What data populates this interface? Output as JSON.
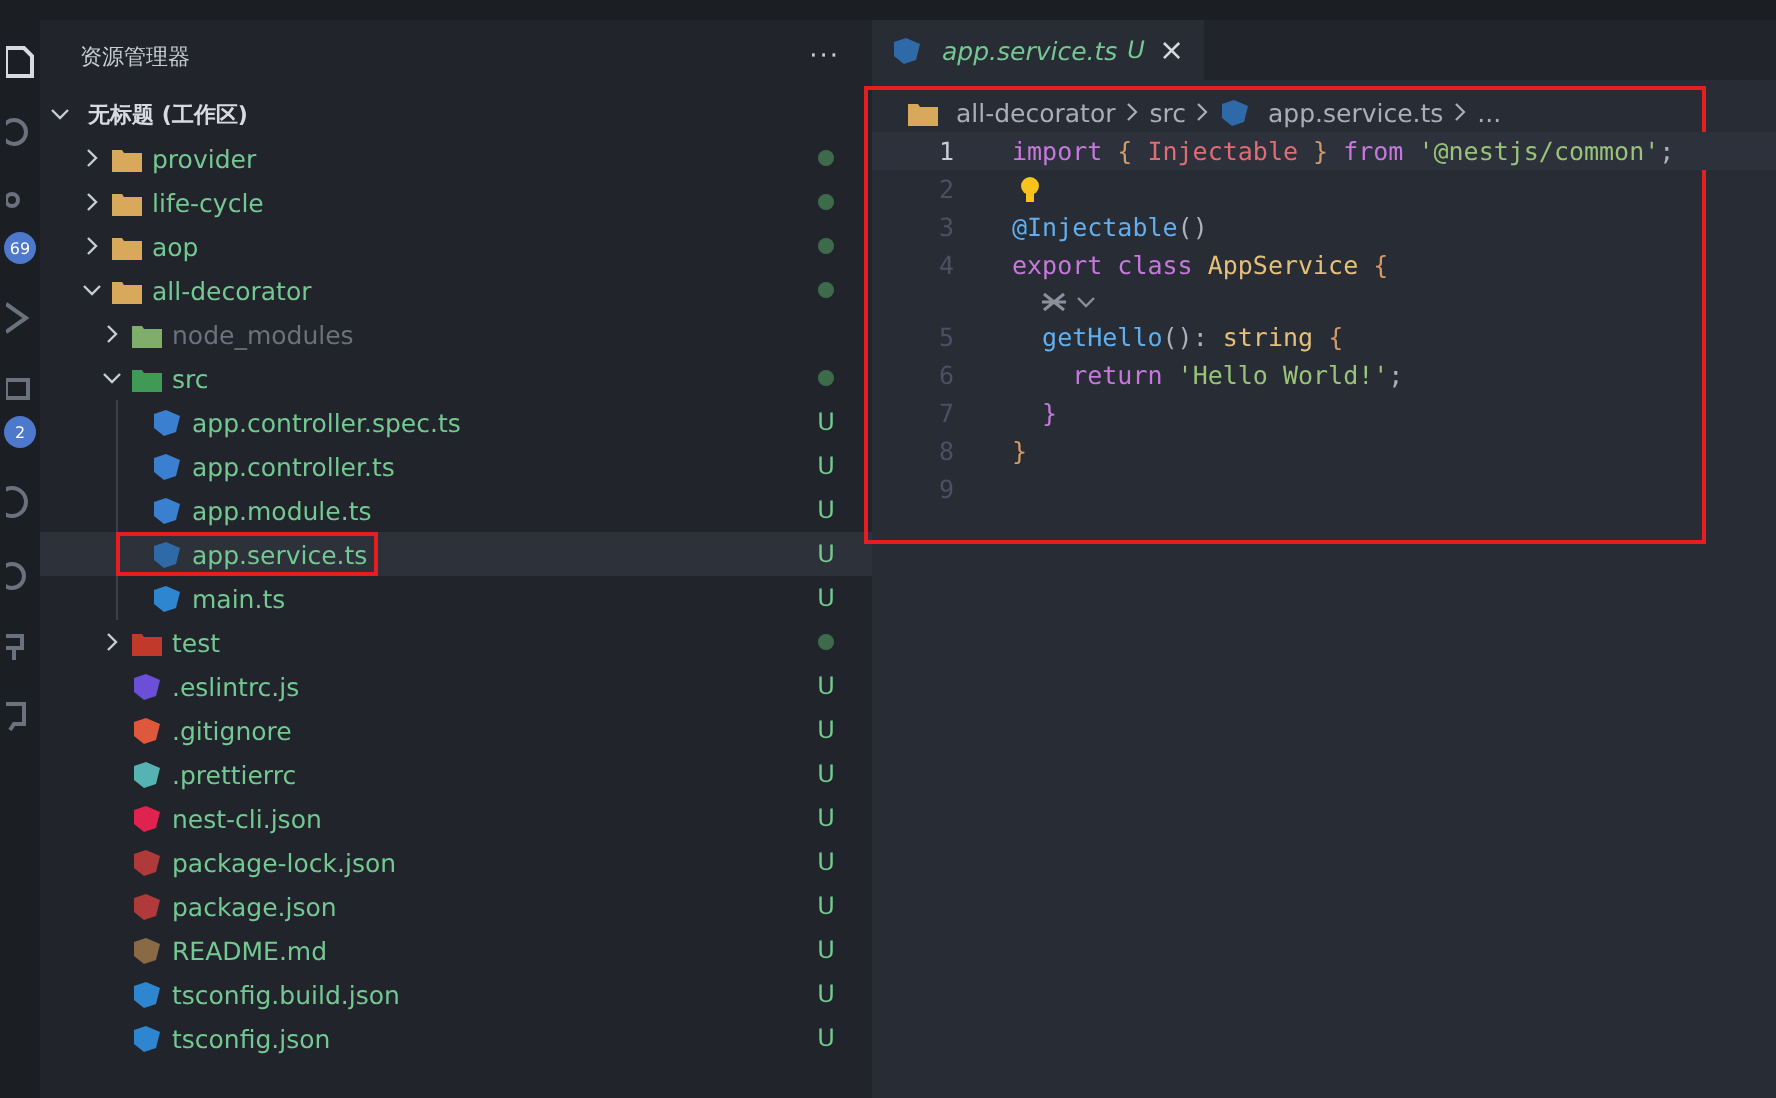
{
  "activity_bar": {
    "badges": [
      "69",
      "2"
    ]
  },
  "explorer": {
    "title": "资源管理器",
    "more": "···",
    "workspace": {
      "label": "无标题 (工作区)",
      "expanded": true
    },
    "tree": [
      {
        "name": "provider",
        "kind": "folder",
        "expanded": false,
        "changed": true,
        "selected": false,
        "dimmed": false,
        "highlighted": false,
        "color": "#d9a95b"
      },
      {
        "name": "life-cycle",
        "kind": "folder",
        "expanded": false,
        "changed": true,
        "selected": false,
        "dimmed": false,
        "highlighted": false,
        "color": "#d9a95b"
      },
      {
        "name": "aop",
        "kind": "folder",
        "expanded": false,
        "changed": true,
        "selected": false,
        "dimmed": false,
        "highlighted": false,
        "color": "#d9a95b"
      },
      {
        "name": "all-decorator",
        "kind": "folder",
        "expanded": true,
        "changed": true,
        "selected": false,
        "dimmed": false,
        "highlighted": false,
        "color": "#d9a95b",
        "children": [
          {
            "name": "node_modules",
            "kind": "folder",
            "expanded": false,
            "changed": false,
            "selected": false,
            "dimmed": true,
            "highlighted": false,
            "color": "#7fae6a"
          },
          {
            "name": "src",
            "kind": "folder",
            "expanded": true,
            "changed": true,
            "selected": false,
            "dimmed": false,
            "highlighted": false,
            "color": "#3f9a55",
            "children": [
              {
                "name": "app.controller.spec.ts",
                "kind": "file",
                "status": "U",
                "selected": false,
                "dimmed": false,
                "highlighted": false,
                "color": "#3a7fd0"
              },
              {
                "name": "app.controller.ts",
                "kind": "file",
                "status": "U",
                "selected": false,
                "dimmed": false,
                "highlighted": false,
                "color": "#3a7fd0"
              },
              {
                "name": "app.module.ts",
                "kind": "file",
                "status": "U",
                "selected": false,
                "dimmed": false,
                "highlighted": false,
                "color": "#3a7fd0"
              },
              {
                "name": "app.service.ts",
                "kind": "file",
                "status": "U",
                "selected": true,
                "dimmed": false,
                "highlighted": true,
                "color": "#2f6aa8"
              },
              {
                "name": "main.ts",
                "kind": "file",
                "status": "U",
                "selected": false,
                "dimmed": false,
                "highlighted": false,
                "color": "#2f86d0"
              }
            ]
          },
          {
            "name": "test",
            "kind": "folder",
            "expanded": false,
            "changed": true,
            "selected": false,
            "dimmed": false,
            "highlighted": false,
            "color": "#c0392b"
          },
          {
            "name": ".eslintrc.js",
            "kind": "file",
            "status": "U",
            "selected": false,
            "dimmed": false,
            "highlighted": false,
            "color": "#6c4fd8"
          },
          {
            "name": ".gitignore",
            "kind": "file",
            "status": "U",
            "selected": false,
            "dimmed": false,
            "highlighted": false,
            "color": "#e0583c"
          },
          {
            "name": ".prettierrc",
            "kind": "file",
            "status": "U",
            "selected": false,
            "dimmed": false,
            "highlighted": false,
            "color": "#56b3b4"
          },
          {
            "name": "nest-cli.json",
            "kind": "file",
            "status": "U",
            "selected": false,
            "dimmed": false,
            "highlighted": false,
            "color": "#e0234e"
          },
          {
            "name": "package-lock.json",
            "kind": "file",
            "status": "U",
            "selected": false,
            "dimmed": false,
            "highlighted": false,
            "color": "#b03a3a"
          },
          {
            "name": "package.json",
            "kind": "file",
            "status": "U",
            "selected": false,
            "dimmed": false,
            "highlighted": false,
            "color": "#b03a3a"
          },
          {
            "name": "README.md",
            "kind": "file",
            "status": "U",
            "selected": false,
            "dimmed": false,
            "highlighted": false,
            "color": "#8a6a45"
          },
          {
            "name": "tsconfig.build.json",
            "kind": "file",
            "status": "U",
            "selected": false,
            "dimmed": false,
            "highlighted": false,
            "color": "#2f86d0"
          },
          {
            "name": "tsconfig.json",
            "kind": "file",
            "status": "U",
            "selected": false,
            "dimmed": false,
            "highlighted": false,
            "color": "#2f86d0"
          }
        ]
      }
    ]
  },
  "editor": {
    "highlighted": true,
    "tabs": [
      {
        "label": "app.service.ts",
        "status": "U",
        "close": "×",
        "selected": true
      }
    ],
    "breadcrumb": [
      "all-decorator",
      "src",
      "app.service.ts",
      "..."
    ],
    "lines": [
      {
        "number": "1",
        "current": true,
        "tokens": [
          {
            "kind": "keyword",
            "text": "import"
          },
          {
            "kind": "punct",
            "text": " { "
          },
          {
            "kind": "type",
            "text": "Injectable"
          },
          {
            "kind": "punct",
            "text": " } "
          },
          {
            "kind": "keyword",
            "text": "from "
          },
          {
            "kind": "string",
            "text": "'@nestjs/common'"
          },
          {
            "kind": "plain",
            "text": ";"
          }
        ]
      },
      {
        "number": "2",
        "current": false,
        "lightbulb": true
      },
      {
        "number": "3",
        "current": false,
        "tokens": [
          {
            "kind": "func",
            "text": "@Injectable"
          },
          {
            "kind": "plain",
            "text": "()"
          }
        ]
      },
      {
        "number": "4",
        "current": false,
        "codelens": true,
        "tokens": [
          {
            "kind": "keyword",
            "text": "export class "
          },
          {
            "kind": "class",
            "text": "AppService "
          },
          {
            "kind": "punct",
            "text": "{"
          }
        ]
      },
      {
        "number": "5",
        "current": false,
        "tokens": [
          {
            "kind": "func",
            "text": "  getHello"
          },
          {
            "kind": "plain",
            "text": "(): "
          },
          {
            "kind": "class",
            "text": "string "
          },
          {
            "kind": "punct",
            "text": "{"
          }
        ]
      },
      {
        "number": "6",
        "current": false,
        "tokens": [
          {
            "kind": "keyword",
            "text": "    return "
          },
          {
            "kind": "string",
            "text": "'Hello World!'"
          },
          {
            "kind": "plain",
            "text": ";"
          }
        ]
      },
      {
        "number": "7",
        "current": false,
        "tokens": [
          {
            "kind": "brace",
            "text": "  }"
          }
        ]
      },
      {
        "number": "8",
        "current": false,
        "tokens": [
          {
            "kind": "punct",
            "text": "}"
          }
        ]
      },
      {
        "number": "9",
        "current": false
      }
    ]
  }
}
